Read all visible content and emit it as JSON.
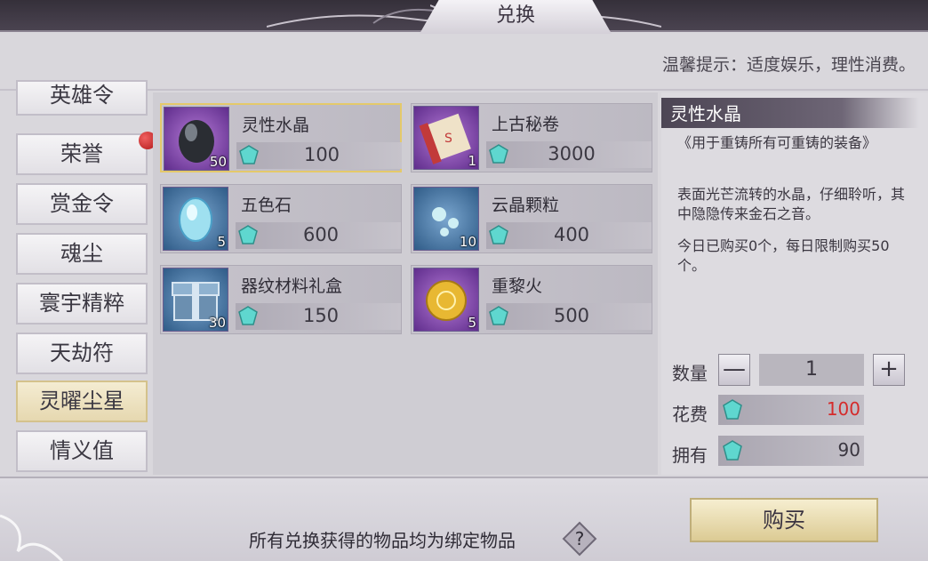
{
  "title": "兑换",
  "notice": "温馨提示：适度娱乐，理性消费。",
  "tabs": [
    {
      "label": "英雄令",
      "active": false,
      "badge": false
    },
    {
      "label": "荣誉",
      "active": false,
      "badge": true
    },
    {
      "label": "赏金令",
      "active": false,
      "badge": false
    },
    {
      "label": "魂尘",
      "active": false,
      "badge": false
    },
    {
      "label": "寰宇精粹",
      "active": false,
      "badge": false
    },
    {
      "label": "天劫符",
      "active": false,
      "badge": false
    },
    {
      "label": "灵曜尘星",
      "active": true,
      "badge": false
    },
    {
      "label": "情义值",
      "active": false,
      "badge": false
    }
  ],
  "items": [
    {
      "name": "灵性水晶",
      "count": "50",
      "price": "100",
      "icon": "black-crystal-icon",
      "frame": "purple",
      "selected": true
    },
    {
      "name": "上古秘卷",
      "count": "1",
      "price": "3000",
      "icon": "ancient-scroll-icon",
      "frame": "purple",
      "selected": false
    },
    {
      "name": "五色石",
      "count": "5",
      "price": "600",
      "icon": "blue-stone-icon",
      "frame": "blue",
      "selected": false
    },
    {
      "name": "云晶颗粒",
      "count": "10",
      "price": "400",
      "icon": "crystal-particles-icon",
      "frame": "blue",
      "selected": false
    },
    {
      "name": "器纹材料礼盒",
      "count": "30",
      "price": "150",
      "icon": "gift-chest-icon",
      "frame": "blue",
      "selected": false
    },
    {
      "name": "重黎火",
      "count": "5",
      "price": "500",
      "icon": "golden-orb-icon",
      "frame": "purple",
      "selected": false
    }
  ],
  "detail": {
    "title": "灵性水晶",
    "usage": "《用于重铸所有可重铸的装备》",
    "description": "表面光芒流转的水晶，仔细聆听，其中隐隐传来金石之音。",
    "limit": "今日已购买0个，每日限制购买50个。",
    "qty_label": "数量",
    "qty_minus": "—",
    "qty_value": "1",
    "qty_plus": "+",
    "cost_label": "花费",
    "cost_value": "100",
    "own_label": "拥有",
    "own_value": "90"
  },
  "bottom_note": "所有兑换获得的物品均为绑定物品",
  "help": "?",
  "buy_label": "购买",
  "colors": {
    "accent_gold": "#e4c96a",
    "cost_red": "#d52b2b",
    "gem": "#5fd7cf"
  }
}
